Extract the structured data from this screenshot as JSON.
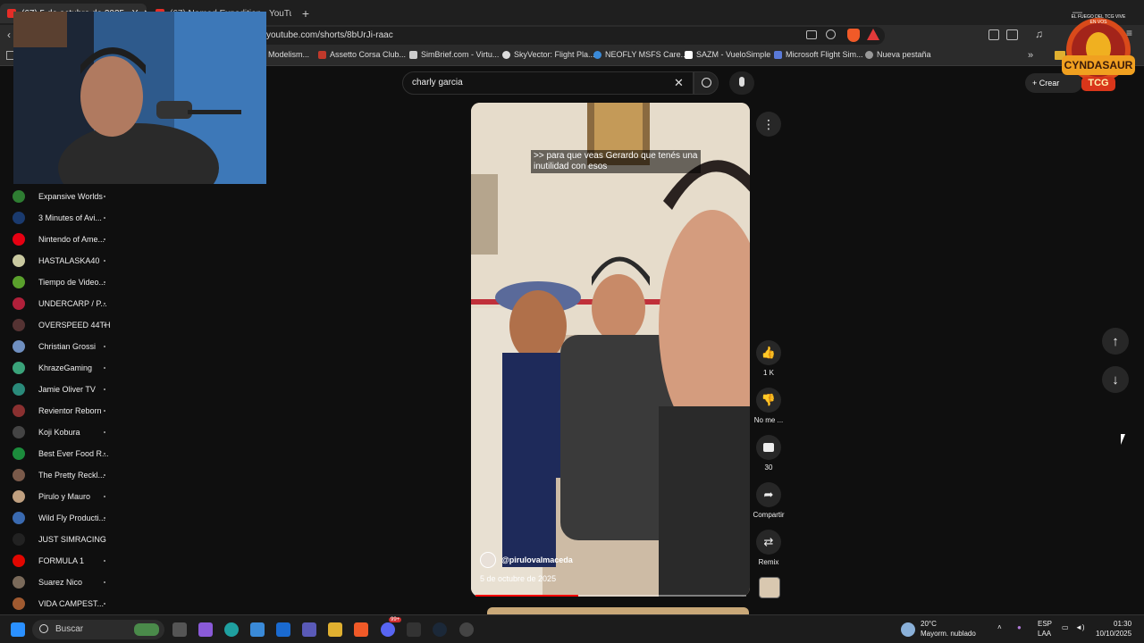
{
  "browser": {
    "tabs": [
      {
        "label": "(67) 5 de octubre de 2025 - Y"
      },
      {
        "label": "(67) Nomad Expedition - YouTube"
      }
    ],
    "new_tab_icon": "plus-icon",
    "url": "youtube.com/shorts/8bUrJi-raac",
    "bookmarks": [
      {
        "label": "Modelism..."
      },
      {
        "label": "Assetto Corsa Club..."
      },
      {
        "label": "SimBrief.com - Virtu..."
      },
      {
        "label": "SkyVector: Flight Pla..."
      },
      {
        "label": "NEOFLY MSFS Care..."
      },
      {
        "label": "SAZM - VueloSimple"
      },
      {
        "label": "Microsoft Flight Sim..."
      },
      {
        "label": "Nueva pestaña"
      }
    ]
  },
  "youtube": {
    "search_value": "charly garcia",
    "create_label": "Crear",
    "subscriptions": [
      {
        "name": "Expansive Worlds",
        "color": "#2e7d32"
      },
      {
        "name": "3 Minutes of Avi...",
        "color": "#1a3a6e"
      },
      {
        "name": "Nintendo of Ame...",
        "color": "#e60012"
      },
      {
        "name": "HASTALASKA40",
        "color": "#c9c9a0"
      },
      {
        "name": "Tiempo de Video...",
        "color": "#5aa02c"
      },
      {
        "name": "UNDERCARP / P...",
        "color": "#b0203a"
      },
      {
        "name": "OVERSPEED 44TH",
        "color": "#553333"
      },
      {
        "name": "Christian Grossi",
        "color": "#6f8fc0"
      },
      {
        "name": "KhrazeGaming",
        "color": "#3aa37a"
      },
      {
        "name": "Jamie Oliver TV",
        "color": "#2a8a7a"
      },
      {
        "name": "Revientor Reborn",
        "color": "#8a3030"
      },
      {
        "name": "Koji Kobura",
        "color": "#444444"
      },
      {
        "name": "Best Ever Food R...",
        "color": "#1c8c3c"
      },
      {
        "name": "The Pretty Reckl...",
        "color": "#7a5a4a"
      },
      {
        "name": "Pirulo y Mauro",
        "color": "#c0a080"
      },
      {
        "name": "Wild Fly Producti...",
        "color": "#3a6ab0"
      },
      {
        "name": "JUST SIMRACING",
        "color": "#222222"
      },
      {
        "name": "FORMULA 1",
        "color": "#e10600"
      },
      {
        "name": "Suarez Nico",
        "color": "#7a6a5a"
      },
      {
        "name": "VIDA CAMPEST...",
        "color": "#a05a30"
      }
    ],
    "short": {
      "caption": ">> para que veas Gerardo que tenés una inutilidad con esos",
      "channel": "@pirulovalmaceda",
      "date": "5 de octubre de 2025",
      "progress": 0.38
    },
    "actions": {
      "like_count": "1 K",
      "dislike_label": "No me ...",
      "comments_count": "30",
      "share_label": "Compartir",
      "remix_label": "Remix"
    }
  },
  "overlay": {
    "logo_top": "EL FUEGO DEL TCG VIVE EN VOS",
    "logo_main": "CYNDASAUR",
    "logo_sub": "TCG"
  },
  "taskbar": {
    "search_placeholder": "Buscar",
    "weather_temp": "20°C",
    "weather_desc": "Mayorm. nublado",
    "lang_top": "ESP",
    "lang_bottom": "LAA",
    "time": "01:30",
    "date": "10/10/2025",
    "badge_count": "99+"
  }
}
